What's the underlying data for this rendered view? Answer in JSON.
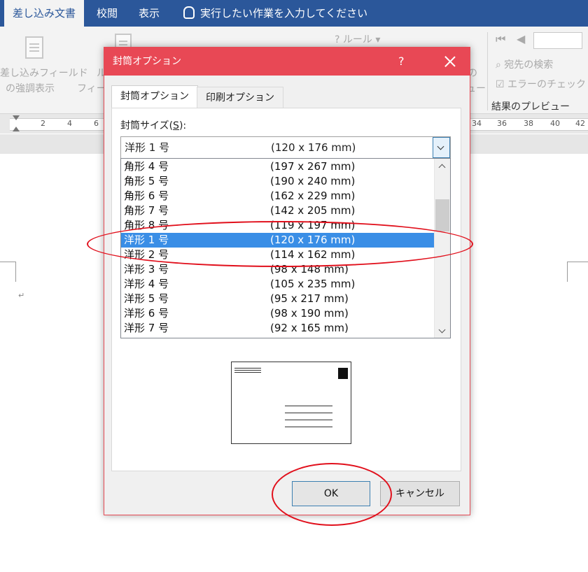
{
  "word": {
    "tabs": [
      {
        "label": "差し込み文書",
        "active": true
      },
      {
        "label": "校閲",
        "active": false
      },
      {
        "label": "表示",
        "active": false
      }
    ],
    "tell_me": "実行したい作業を入力してください",
    "ribbon": {
      "highlight_fields_1": "差し込みフィールド",
      "highlight_fields_2": "の強調表示",
      "rules": "ルール",
      "find_recipient": "宛先の検索",
      "check_errors": "エラーのチェック",
      "preview_results": "結果のプレビュー",
      "frag_1": "ル",
      "frag_2": "フィー",
      "frag_3": "の",
      "frag_4": "ュー"
    },
    "ruler_numbers_left": [
      "2",
      "4",
      "6"
    ],
    "ruler_numbers_right": [
      "34",
      "36",
      "38",
      "40",
      "42"
    ]
  },
  "dialog": {
    "title": "封筒オプション",
    "help": "?",
    "tabs": [
      {
        "label": "封筒オプション",
        "active": true
      },
      {
        "label": "印刷オプション",
        "active": false
      }
    ],
    "size_label_prefix": "封筒サイズ(",
    "size_label_key": "S",
    "size_label_suffix": "):",
    "selected": {
      "name": "洋形 1 号",
      "dims": "(120 x 176 mm)"
    },
    "items": [
      {
        "name": "角形 4 号",
        "dims": "(197 x 267 mm)"
      },
      {
        "name": "角形 5 号",
        "dims": "(190 x 240 mm)"
      },
      {
        "name": "角形 6 号",
        "dims": "(162 x 229 mm)"
      },
      {
        "name": "角形 7 号",
        "dims": "(142 x 205 mm)"
      },
      {
        "name": "角形 8 号",
        "dims": "(119 x 197 mm)"
      },
      {
        "name": "洋形 1 号",
        "dims": "(120 x 176 mm)",
        "selected": true
      },
      {
        "name": "洋形 2 号",
        "dims": "(114 x 162 mm)"
      },
      {
        "name": "洋形 3 号",
        "dims": "(98 x 148 mm)"
      },
      {
        "name": "洋形 4 号",
        "dims": "(105 x 235 mm)"
      },
      {
        "name": "洋形 5 号",
        "dims": "(95 x 217 mm)"
      },
      {
        "name": "洋形 6 号",
        "dims": "(98 x 190 mm)"
      },
      {
        "name": "洋形 7 号",
        "dims": "(92 x 165 mm)"
      }
    ],
    "ok": "OK",
    "cancel": "キャンセル"
  },
  "colors": {
    "word_blue": "#2b579a",
    "dialog_title": "#e84855",
    "selection": "#3a8ee6",
    "annotation": "#e1101c"
  }
}
